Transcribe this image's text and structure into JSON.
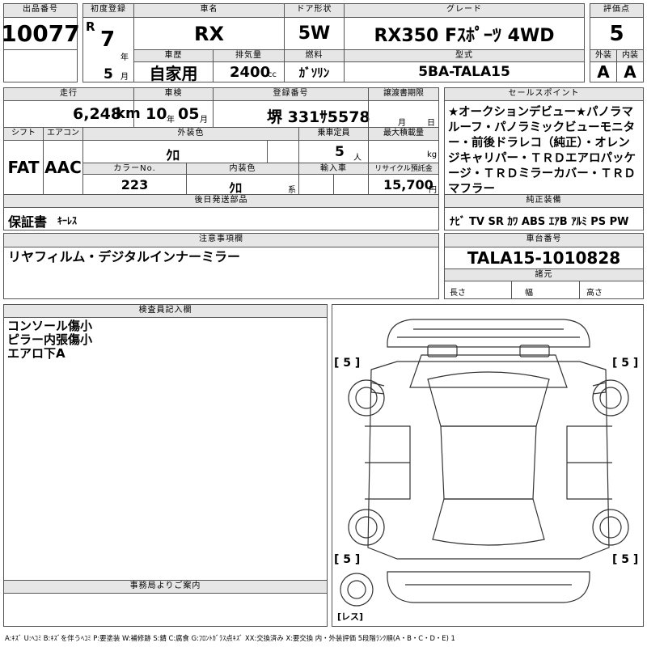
{
  "lot": {
    "label": "出品番号",
    "value": "10077"
  },
  "first_reg": {
    "label": "初度登録",
    "era": "R",
    "year": "7",
    "year_unit": "年",
    "month": "5",
    "month_unit": "月"
  },
  "car_name": {
    "label": "車名",
    "value": "RX"
  },
  "door": {
    "label": "ドア形状",
    "value": "5W"
  },
  "grade": {
    "label": "グレード",
    "value": "RX350 Fｽﾎﾟｰﾂ 4WD"
  },
  "score": {
    "label": "評価点",
    "value": "5"
  },
  "history": {
    "label": "車歴",
    "value": "自家用"
  },
  "displacement": {
    "label": "排気量",
    "value": "2400",
    "unit": "cc"
  },
  "fuel": {
    "label": "燃料",
    "value": "ｶﾞｿﾘﾝ"
  },
  "model": {
    "label": "型式",
    "value": "5BA-TALA15"
  },
  "ext_score": {
    "label": "外装",
    "value": "A"
  },
  "int_score": {
    "label": "内装",
    "value": "A"
  },
  "mileage": {
    "label": "走行",
    "value": "6,248",
    "unit": "km"
  },
  "inspection": {
    "label": "車検",
    "year": "10",
    "year_unit": "年",
    "month": "05",
    "month_unit": "月"
  },
  "plate": {
    "label": "登録番号",
    "value": "堺 331ｻ5578"
  },
  "transfer": {
    "label": "譲渡書期限",
    "month_unit": "月",
    "day_unit": "日"
  },
  "sales_point": {
    "label": "セールスポイント",
    "text": "★オークションデビュー★パノラマルーフ・パノラミックビューモニター・前後ドラレコ（純正）・オレンジキャリパー・ＴＲＤエアロパッケージ・ＴＲＤミラーカバー・ＴＲＤマフラー"
  },
  "shift": {
    "label": "シフト",
    "value": "FAT"
  },
  "aircon": {
    "label": "エアコン",
    "value": "AAC"
  },
  "ext_color": {
    "label": "外装色",
    "value": "ｸﾛ"
  },
  "capacity": {
    "label": "乗車定員",
    "value": "5",
    "unit": "人"
  },
  "max_load": {
    "label": "最大積載量",
    "unit": "kg"
  },
  "color_no": {
    "label": "カラーNo.",
    "value": "223"
  },
  "int_color": {
    "label": "内装色",
    "value": "ｸﾛ",
    "unit": "系"
  },
  "import": {
    "label": "輸入車"
  },
  "recycle": {
    "label": "リサイクル預託金",
    "value": "15,700",
    "unit": "円"
  },
  "later_parts": {
    "label": "後日発送部品",
    "items": [
      "保証書",
      "ｷｰﾚｽ"
    ]
  },
  "equipment": {
    "label": "純正装備",
    "value": "ﾅﾋﾞ TV SR ｶﾜ ABS ｴｱB ｱﾙﾐ PS PW"
  },
  "notes": {
    "label": "注意事項欄",
    "value": "リヤフィルム・デジタルインナーミラー"
  },
  "chassis": {
    "label": "車台番号",
    "value": "TALA15-1010828"
  },
  "specs": {
    "label": "諸元",
    "length": "長さ",
    "width": "幅",
    "height": "高さ"
  },
  "inspector": {
    "label": "検査員記入欄",
    "lines": [
      "コンソール傷小",
      "ピラー内張傷小",
      "エアロ下A"
    ]
  },
  "diagram": {
    "tires": [
      "[ 5 ]",
      "[ 5 ]",
      "[ 5 ]",
      "[ 5 ]"
    ],
    "spare": "レス"
  },
  "office": {
    "label": "事務局よりご案内"
  },
  "legend": "A:ｷｽﾞ U:ﾍｺﾐ B:ｷｽﾞを伴うﾍｺﾐ P:要塗装 W:補修跡 S:錆 C:腐食 G:ﾌﾛﾝﾄｶﾞﾗｽ点ｷｽﾞ XX:交換済み X:要交換 内・外装評価 5段階ﾗﾝｸ順(A・B・C・D・E) 1"
}
